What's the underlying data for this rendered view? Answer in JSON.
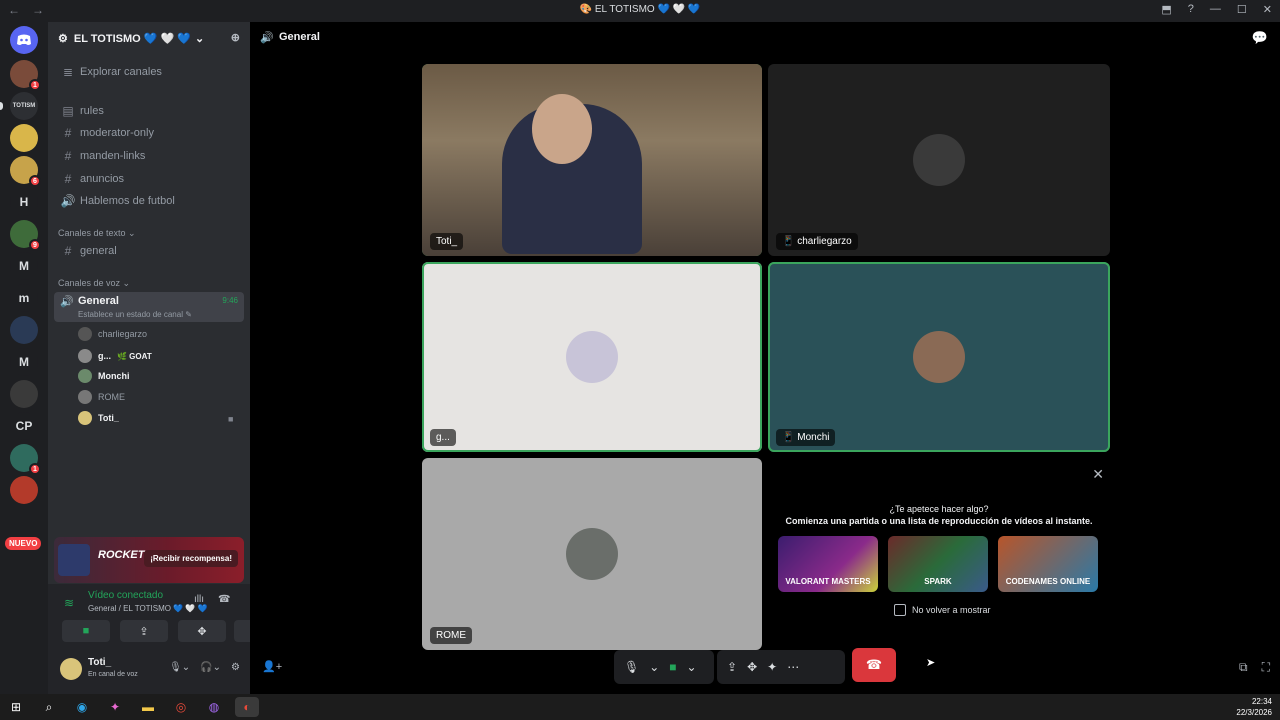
{
  "window": {
    "title": "🎨 EL TOTISMO 💙 🤍 💙",
    "back_icon": "←",
    "forward_icon": "→"
  },
  "rail": {
    "servers": [
      {
        "label": "",
        "badge": "1",
        "color": "#7a4b3a"
      },
      {
        "label": "TOTISM",
        "badge": "",
        "color": "#2d2f33"
      },
      {
        "label": "",
        "badge": "",
        "color": "#d9b64a"
      },
      {
        "label": "",
        "badge": "6",
        "color": "#c7a34a"
      },
      {
        "label": "H",
        "badge": "",
        "color": "#1e1f22"
      },
      {
        "label": "",
        "badge": "9",
        "color": "#3e6b3a"
      },
      {
        "label": "M",
        "badge": "",
        "color": "#1e1f22"
      },
      {
        "label": "m",
        "badge": "",
        "color": "#1e1f22"
      },
      {
        "label": "",
        "badge": "",
        "color": "#2a3a55"
      },
      {
        "label": "M",
        "badge": "",
        "color": "#1e1f22"
      },
      {
        "label": "",
        "badge": "",
        "color": "#3a3a3a"
      },
      {
        "label": "CP",
        "badge": "",
        "color": "#1e1f22"
      },
      {
        "label": "",
        "badge": "1",
        "color": "#2f6b5e"
      },
      {
        "label": "",
        "badge": "",
        "color": "#b33a2a"
      }
    ],
    "nuevo": "NUEVO"
  },
  "sidebar": {
    "server_name": "EL TOTISMO 💙 🤍 💙",
    "explore": "Explorar canales",
    "channels": [
      {
        "name": "rules",
        "glyph": "▤"
      },
      {
        "name": "moderator-only",
        "glyph": "#"
      },
      {
        "name": "manden-links",
        "glyph": "#"
      },
      {
        "name": "anuncios",
        "glyph": "#"
      },
      {
        "name": "Hablemos de futbol",
        "glyph": "🔊"
      }
    ],
    "text_category": "Canales de texto",
    "text_channels": [
      {
        "name": "general",
        "glyph": "#"
      }
    ],
    "voice_category": "Canales de voz",
    "voice_channel": {
      "name": "General",
      "time": "9:46",
      "status": "Establece un estado de canal ✎"
    },
    "voice_users": [
      {
        "name": "charliegarzo",
        "extra": "",
        "color": "#555",
        "bright": false
      },
      {
        "name": "g...",
        "extra": "🌿 GOAT",
        "color": "#8a8a8a",
        "bright": true
      },
      {
        "name": "Monchi",
        "extra": "",
        "color": "#6b8a6b",
        "bright": true
      },
      {
        "name": "ROME",
        "extra": "",
        "color": "#777",
        "bright": false
      },
      {
        "name": "Toti_",
        "extra": "",
        "color": "#d9c47a",
        "bright": true
      }
    ]
  },
  "promo": {
    "title": "ROCKET LEAGUE",
    "button": "¡Recibir recompensa!"
  },
  "voice_connected": {
    "label": "Vídeo conectado",
    "sub": "General / EL TOTISMO 💙 🤍 💙"
  },
  "user": {
    "name": "Toti_",
    "status": "En canal de voz"
  },
  "main": {
    "channel": "General",
    "tiles": [
      {
        "name": "Toti_",
        "bg": "#7a6a55",
        "speaking": true
      },
      {
        "name": "charliegarzo",
        "bg": "#1f1f1f",
        "speaking": false
      },
      {
        "name": "g...",
        "bg": "#e6e4e2",
        "speaking": true
      },
      {
        "name": "Monchi",
        "bg": "#2a5158",
        "speaking": true
      },
      {
        "name": "ROME",
        "bg": "#a9a9a9",
        "speaking": false
      }
    ]
  },
  "activity": {
    "question": "¿Te apetece hacer algo?",
    "subtitle": "Comienza una partida o una lista de reproducción de vídeos al instante.",
    "games": [
      {
        "name": "VALORANT MASTERS",
        "bg": "linear-gradient(135deg,#3b1d6e,#8a2a8a 60%,#c9d23a)"
      },
      {
        "name": "SPARK",
        "bg": "linear-gradient(135deg,#6b2a2a,#2a6b3a 50%,#3a5a8a)"
      },
      {
        "name": "CODENAMES ONLINE",
        "bg": "linear-gradient(135deg,#b8552a,#2a7aa8)"
      }
    ],
    "dont_show": "No volver a mostrar"
  },
  "clock": {
    "time": "22:34",
    "date": "22/3/2026"
  }
}
